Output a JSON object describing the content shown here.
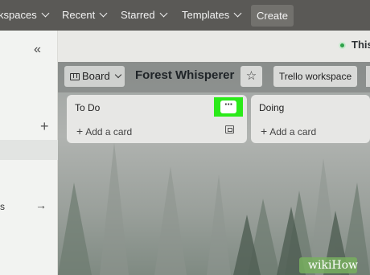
{
  "nav": {
    "items": [
      {
        "label": "kspaces"
      },
      {
        "label": "Recent"
      },
      {
        "label": "Starred"
      },
      {
        "label": "Templates"
      }
    ],
    "create_label": "Create"
  },
  "subheader": {
    "status_text": "This"
  },
  "sidebar": {
    "collapse_glyph": "«",
    "plus_glyph": "+",
    "truncated_text": "s",
    "arrow_glyph": "→"
  },
  "board": {
    "view_label": "Board",
    "title": "Forest Whisperer",
    "star_glyph": "☆",
    "workspace_label": "Trello workspace"
  },
  "lists": [
    {
      "title": "To Do",
      "add_card_label": "Add a card",
      "menu_glyph": "···",
      "highlighted": true
    },
    {
      "title": "Doing",
      "add_card_label": "Add a card"
    }
  ],
  "watermark": {
    "text": "wikiHow"
  },
  "colors": {
    "nav_bg": "#5a5956",
    "highlight": "#2bea19",
    "status_dot": "#2fa24a"
  }
}
